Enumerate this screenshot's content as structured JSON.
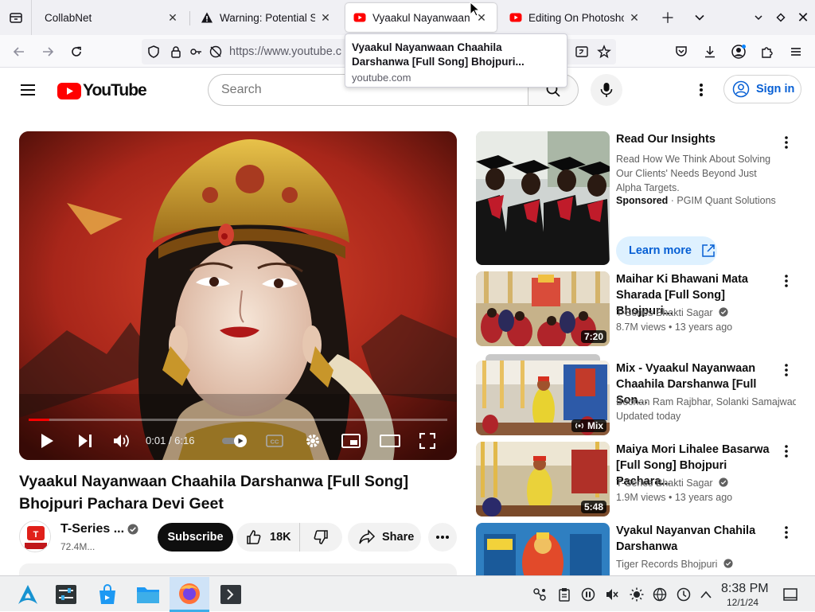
{
  "browser": {
    "tabs": [
      {
        "title": "CollabNet",
        "icon": "none",
        "active": false
      },
      {
        "title": "Warning: Potential Se",
        "icon": "warning-icon",
        "active": false
      },
      {
        "title": "Vyaakul Nayanwaan",
        "icon": "youtube-icon",
        "active": true
      },
      {
        "title": "Editing On Photoshop",
        "icon": "youtube-icon",
        "active": false
      }
    ],
    "url": "https://www.youtube.c",
    "tooltip": {
      "title": "Vyaakul Nayanwaan Chaahila Darshanwa [Full Song] Bhojpuri...",
      "url": "youtube.com"
    }
  },
  "youtube": {
    "logo_text": "YouTube",
    "search_placeholder": "Search",
    "sign_in_label": "Sign in",
    "player": {
      "current_time": "0:01",
      "duration": "6:16",
      "time_label": "0:01 / 6:16",
      "progress": 0.05
    },
    "video": {
      "title": "Vyaakul Nayanwaan Chaahila Darshanwa [Full Song] Bhojpuri Pachara Devi Geet",
      "channel": "T-Series ...",
      "subscribers": "72.4M...",
      "subscribe_label": "Subscribe",
      "likes": "18K",
      "share_label": "Share"
    },
    "sidebar": {
      "ad": {
        "title": "Read Our Insights",
        "description": "Read How We Think About Solving Our Clients' Needs Beyond Just Alpha Targets.",
        "sponsored_label": "Sponsored",
        "advertiser": "PGIM Quant Solutions",
        "cta": "Learn more"
      },
      "items": [
        {
          "title": "Maihar Ki Bhawani Mata Sharada [Full Song] Bhojpuri...",
          "channel": "T-Series Bhakti Sagar",
          "verified": true,
          "meta": "8.7M views • 13 years ago",
          "duration": "7:20"
        },
        {
          "title": "Mix - Vyaakul Nayanwaan Chaahila Darshanwa [Full Son...",
          "channel": "Bechan Ram Rajbhar, Solanki Samajwadi...",
          "verified": false,
          "meta": "Updated today",
          "duration": "Mix"
        },
        {
          "title": "Maiya Mori Lihalee Basarwa [Full Song] Bhojpuri Pachara...",
          "channel": "T-Series Bhakti Sagar",
          "verified": true,
          "meta": "1.9M views • 13 years ago",
          "duration": "5:48"
        },
        {
          "title": "Vyakul Nayanvan Chahila Darshanwa",
          "channel": "Tiger Records Bhojpuri",
          "verified": true,
          "meta": "",
          "duration": ""
        }
      ]
    }
  },
  "taskbar": {
    "time": "8:38 PM",
    "date": "12/1/24"
  }
}
